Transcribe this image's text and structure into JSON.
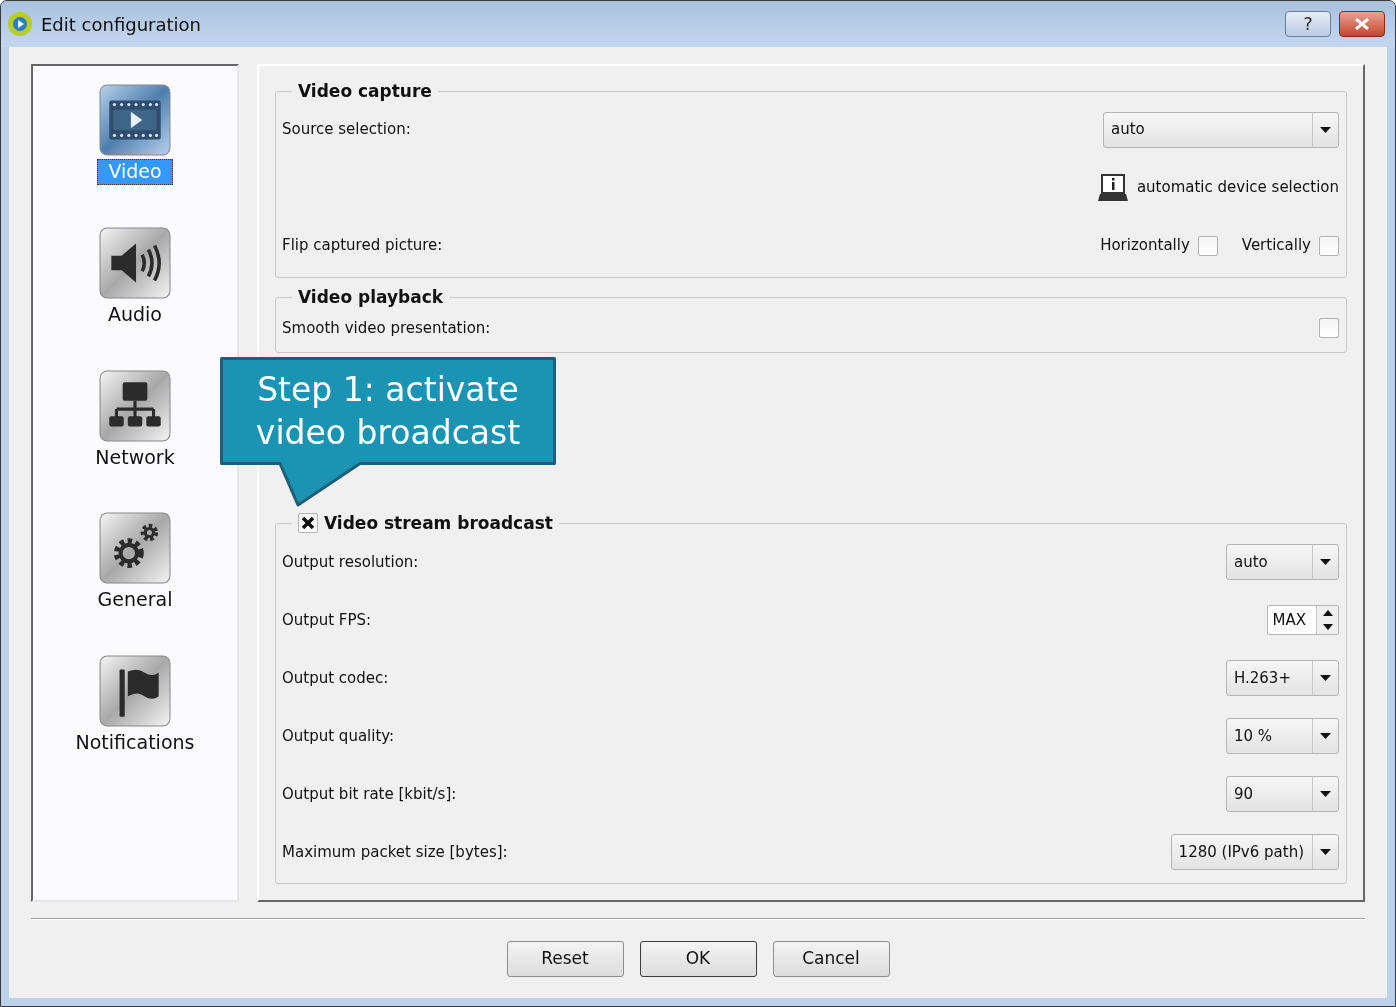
{
  "window": {
    "title": "Edit configuration",
    "help": "?"
  },
  "sidebar": {
    "items": [
      {
        "label": "Video",
        "kind": "video",
        "selected": true
      },
      {
        "label": "Audio",
        "kind": "audio",
        "selected": false
      },
      {
        "label": "Network",
        "kind": "network",
        "selected": false
      },
      {
        "label": "General",
        "kind": "general",
        "selected": false
      },
      {
        "label": "Notifications",
        "kind": "notifications",
        "selected": false
      }
    ]
  },
  "groups": [
    {
      "title": "Video capture",
      "rows": [
        {
          "kind": "combo",
          "label": "Source selection:",
          "value": "auto"
        },
        {
          "kind": "info",
          "text": "automatic device selection"
        },
        {
          "kind": "checks",
          "label": "Flip captured picture:",
          "options": [
            {
              "label": "Horizontally",
              "checked": false
            },
            {
              "label": "Vertically",
              "checked": false
            }
          ]
        }
      ]
    },
    {
      "title": "Video playback",
      "rows": [
        {
          "kind": "check",
          "label": "Smooth video presentation:",
          "checked": false
        }
      ]
    },
    {
      "title": "Video stream broadcast",
      "checked": true,
      "rows": [
        {
          "kind": "combo",
          "label": "Output resolution:",
          "value": "auto"
        },
        {
          "kind": "spin",
          "label": "Output FPS:",
          "value": "MAX"
        },
        {
          "kind": "combo",
          "label": "Output codec:",
          "value": "H.263+"
        },
        {
          "kind": "combo",
          "label": "Output quality:",
          "value": "10 %"
        },
        {
          "kind": "combo",
          "label": "Output bit rate [kbit/s]:",
          "value": "90"
        },
        {
          "kind": "combo",
          "label": "Maximum packet size [bytes]:",
          "value": "1280 (IPv6 path)"
        }
      ]
    }
  ],
  "callout": {
    "text": "Step 1: activate video broadcast"
  },
  "buttons": [
    "Reset",
    "OK",
    "Cancel"
  ]
}
